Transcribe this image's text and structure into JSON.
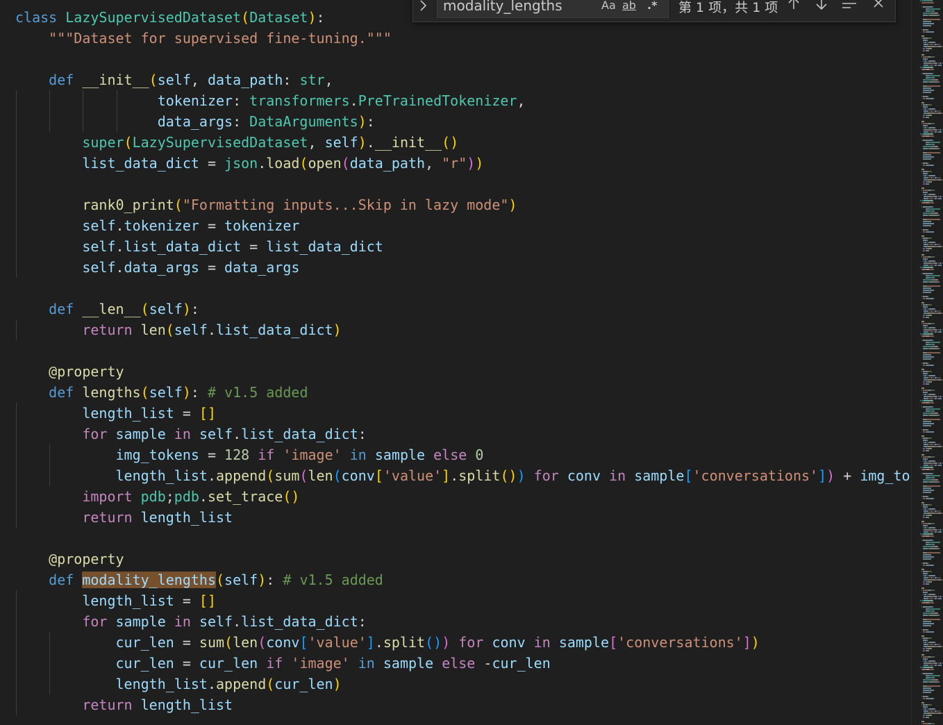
{
  "find_widget": {
    "query": "modality_lengths",
    "match_case_label": "Aa",
    "whole_word_label": "ab",
    "regex_label": ".*",
    "result_count": "第 1 项，共 1 项",
    "toggle_replace_icon": "chevron-right-icon",
    "previous_match_icon": "arrow-up-icon",
    "next_match_icon": "arrow-down-icon",
    "find_in_selection_icon": "lines-icon",
    "close_icon": "close-icon"
  },
  "code": {
    "lines": [
      [
        {
          "t": "class",
          "c": "kw"
        },
        {
          "t": " "
        },
        {
          "t": "LazySupervisedDataset",
          "c": "cls"
        },
        {
          "t": "(",
          "c": "b1"
        },
        {
          "t": "Dataset",
          "c": "cls"
        },
        {
          "t": ")",
          "c": "b1"
        },
        {
          "t": ":"
        }
      ],
      [
        {
          "t": "    "
        },
        {
          "t": "\"\"\"Dataset for supervised fine-tuning.\"\"\"",
          "c": "str"
        }
      ],
      [],
      [
        {
          "t": "    "
        },
        {
          "t": "def",
          "c": "kw"
        },
        {
          "t": " "
        },
        {
          "t": "__init__",
          "c": "fn"
        },
        {
          "t": "(",
          "c": "b1"
        },
        {
          "t": "self",
          "c": "var"
        },
        {
          "t": ", "
        },
        {
          "t": "data_path",
          "c": "var"
        },
        {
          "t": ": "
        },
        {
          "t": "str",
          "c": "cls"
        },
        {
          "t": ","
        }
      ],
      [
        {
          "t": "                 "
        },
        {
          "t": "tokenizer",
          "c": "var"
        },
        {
          "t": ": "
        },
        {
          "t": "transformers",
          "c": "cls"
        },
        {
          "t": "."
        },
        {
          "t": "PreTrainedTokenizer",
          "c": "cls"
        },
        {
          "t": ","
        }
      ],
      [
        {
          "t": "                 "
        },
        {
          "t": "data_args",
          "c": "var"
        },
        {
          "t": ": "
        },
        {
          "t": "DataArguments",
          "c": "cls"
        },
        {
          "t": ")",
          "c": "b1"
        },
        {
          "t": ":"
        }
      ],
      [
        {
          "t": "        "
        },
        {
          "t": "super",
          "c": "cls"
        },
        {
          "t": "(",
          "c": "b1"
        },
        {
          "t": "LazySupervisedDataset",
          "c": "cls"
        },
        {
          "t": ", "
        },
        {
          "t": "self",
          "c": "var"
        },
        {
          "t": ")",
          "c": "b1"
        },
        {
          "t": "."
        },
        {
          "t": "__init__",
          "c": "fn"
        },
        {
          "t": "()",
          "c": "b1"
        }
      ],
      [
        {
          "t": "        "
        },
        {
          "t": "list_data_dict",
          "c": "var"
        },
        {
          "t": " = "
        },
        {
          "t": "json",
          "c": "cls"
        },
        {
          "t": "."
        },
        {
          "t": "load",
          "c": "fn"
        },
        {
          "t": "(",
          "c": "b1"
        },
        {
          "t": "open",
          "c": "fn"
        },
        {
          "t": "(",
          "c": "b2"
        },
        {
          "t": "data_path",
          "c": "var"
        },
        {
          "t": ", "
        },
        {
          "t": "\"r\"",
          "c": "str"
        },
        {
          "t": ")",
          "c": "b2"
        },
        {
          "t": ")",
          "c": "b1"
        }
      ],
      [],
      [
        {
          "t": "        "
        },
        {
          "t": "rank0_print",
          "c": "fn"
        },
        {
          "t": "(",
          "c": "b1"
        },
        {
          "t": "\"Formatting inputs...Skip in lazy mode\"",
          "c": "str"
        },
        {
          "t": ")",
          "c": "b1"
        }
      ],
      [
        {
          "t": "        "
        },
        {
          "t": "self",
          "c": "var"
        },
        {
          "t": "."
        },
        {
          "t": "tokenizer",
          "c": "var"
        },
        {
          "t": " = "
        },
        {
          "t": "tokenizer",
          "c": "var"
        }
      ],
      [
        {
          "t": "        "
        },
        {
          "t": "self",
          "c": "var"
        },
        {
          "t": "."
        },
        {
          "t": "list_data_dict",
          "c": "var"
        },
        {
          "t": " = "
        },
        {
          "t": "list_data_dict",
          "c": "var"
        }
      ],
      [
        {
          "t": "        "
        },
        {
          "t": "self",
          "c": "var"
        },
        {
          "t": "."
        },
        {
          "t": "data_args",
          "c": "var"
        },
        {
          "t": " = "
        },
        {
          "t": "data_args",
          "c": "var"
        }
      ],
      [],
      [
        {
          "t": "    "
        },
        {
          "t": "def",
          "c": "kw"
        },
        {
          "t": " "
        },
        {
          "t": "__len__",
          "c": "fn"
        },
        {
          "t": "(",
          "c": "b1"
        },
        {
          "t": "self",
          "c": "var"
        },
        {
          "t": ")",
          "c": "b1"
        },
        {
          "t": ":"
        }
      ],
      [
        {
          "t": "        "
        },
        {
          "t": "return",
          "c": "ctl"
        },
        {
          "t": " "
        },
        {
          "t": "len",
          "c": "fn"
        },
        {
          "t": "(",
          "c": "b1"
        },
        {
          "t": "self",
          "c": "var"
        },
        {
          "t": "."
        },
        {
          "t": "list_data_dict",
          "c": "var"
        },
        {
          "t": ")",
          "c": "b1"
        }
      ],
      [],
      [
        {
          "t": "    "
        },
        {
          "t": "@property",
          "c": "dec"
        }
      ],
      [
        {
          "t": "    "
        },
        {
          "t": "def",
          "c": "kw"
        },
        {
          "t": " "
        },
        {
          "t": "lengths",
          "c": "fn"
        },
        {
          "t": "(",
          "c": "b1"
        },
        {
          "t": "self",
          "c": "var"
        },
        {
          "t": ")",
          "c": "b1"
        },
        {
          "t": ": "
        },
        {
          "t": "# v1.5 added",
          "c": "com"
        }
      ],
      [
        {
          "t": "        "
        },
        {
          "t": "length_list",
          "c": "var"
        },
        {
          "t": " = "
        },
        {
          "t": "[]",
          "c": "b1"
        }
      ],
      [
        {
          "t": "        "
        },
        {
          "t": "for",
          "c": "ctl"
        },
        {
          "t": " "
        },
        {
          "t": "sample",
          "c": "var"
        },
        {
          "t": " "
        },
        {
          "t": "in",
          "c": "ctl"
        },
        {
          "t": " "
        },
        {
          "t": "self",
          "c": "var"
        },
        {
          "t": "."
        },
        {
          "t": "list_data_dict",
          "c": "var"
        },
        {
          "t": ":"
        }
      ],
      [
        {
          "t": "            "
        },
        {
          "t": "img_tokens",
          "c": "var"
        },
        {
          "t": " = "
        },
        {
          "t": "128",
          "c": "num"
        },
        {
          "t": " "
        },
        {
          "t": "if",
          "c": "ctl"
        },
        {
          "t": " "
        },
        {
          "t": "'image'",
          "c": "str"
        },
        {
          "t": " "
        },
        {
          "t": "in",
          "c": "kw"
        },
        {
          "t": " "
        },
        {
          "t": "sample",
          "c": "var"
        },
        {
          "t": " "
        },
        {
          "t": "else",
          "c": "ctl"
        },
        {
          "t": " "
        },
        {
          "t": "0",
          "c": "num"
        }
      ],
      [
        {
          "t": "            "
        },
        {
          "t": "length_list",
          "c": "var"
        },
        {
          "t": "."
        },
        {
          "t": "append",
          "c": "fn"
        },
        {
          "t": "(",
          "c": "b1"
        },
        {
          "t": "sum",
          "c": "fn"
        },
        {
          "t": "(",
          "c": "b2"
        },
        {
          "t": "len",
          "c": "fn"
        },
        {
          "t": "(",
          "c": "b3"
        },
        {
          "t": "conv",
          "c": "var"
        },
        {
          "t": "[",
          "c": "b1"
        },
        {
          "t": "'value'",
          "c": "str"
        },
        {
          "t": "]",
          "c": "b1"
        },
        {
          "t": "."
        },
        {
          "t": "split",
          "c": "fn"
        },
        {
          "t": "()",
          "c": "b1"
        },
        {
          "t": ")",
          "c": "b3"
        },
        {
          "t": " "
        },
        {
          "t": "for",
          "c": "ctl"
        },
        {
          "t": " "
        },
        {
          "t": "conv",
          "c": "var"
        },
        {
          "t": " "
        },
        {
          "t": "in",
          "c": "ctl"
        },
        {
          "t": " "
        },
        {
          "t": "sample",
          "c": "var"
        },
        {
          "t": "[",
          "c": "b3"
        },
        {
          "t": "'conversations'",
          "c": "str"
        },
        {
          "t": "]",
          "c": "b3"
        },
        {
          "t": ")",
          "c": "b2"
        },
        {
          "t": " + "
        },
        {
          "t": "img_tokens",
          "c": "var"
        },
        {
          "t": ")",
          "c": "b1"
        }
      ],
      [
        {
          "t": "        "
        },
        {
          "t": "import",
          "c": "ctl"
        },
        {
          "t": " "
        },
        {
          "t": "pdb",
          "c": "cls"
        },
        {
          "t": ";"
        },
        {
          "t": "pdb",
          "c": "cls"
        },
        {
          "t": "."
        },
        {
          "t": "set_trace",
          "c": "fn"
        },
        {
          "t": "()",
          "c": "b1"
        }
      ],
      [
        {
          "t": "        "
        },
        {
          "t": "return",
          "c": "ctl"
        },
        {
          "t": " "
        },
        {
          "t": "length_list",
          "c": "var"
        }
      ],
      [],
      [
        {
          "t": "    "
        },
        {
          "t": "@property",
          "c": "dec"
        }
      ],
      [
        {
          "t": "    "
        },
        {
          "t": "def",
          "c": "kw"
        },
        {
          "t": " "
        },
        {
          "t": "modality_lengths",
          "c": "hl"
        },
        {
          "t": "(",
          "c": "b1"
        },
        {
          "t": "self",
          "c": "var"
        },
        {
          "t": ")",
          "c": "b1"
        },
        {
          "t": ": "
        },
        {
          "t": "# v1.5 added",
          "c": "com"
        }
      ],
      [
        {
          "t": "        "
        },
        {
          "t": "length_list",
          "c": "var"
        },
        {
          "t": " = "
        },
        {
          "t": "[]",
          "c": "b1"
        }
      ],
      [
        {
          "t": "        "
        },
        {
          "t": "for",
          "c": "ctl"
        },
        {
          "t": " "
        },
        {
          "t": "sample",
          "c": "var"
        },
        {
          "t": " "
        },
        {
          "t": "in",
          "c": "ctl"
        },
        {
          "t": " "
        },
        {
          "t": "self",
          "c": "var"
        },
        {
          "t": "."
        },
        {
          "t": "list_data_dict",
          "c": "var"
        },
        {
          "t": ":"
        }
      ],
      [
        {
          "t": "            "
        },
        {
          "t": "cur_len",
          "c": "var"
        },
        {
          "t": " = "
        },
        {
          "t": "sum",
          "c": "fn"
        },
        {
          "t": "(",
          "c": "b1"
        },
        {
          "t": "len",
          "c": "fn"
        },
        {
          "t": "(",
          "c": "b2"
        },
        {
          "t": "conv",
          "c": "var"
        },
        {
          "t": "[",
          "c": "b3"
        },
        {
          "t": "'value'",
          "c": "str"
        },
        {
          "t": "]",
          "c": "b3"
        },
        {
          "t": "."
        },
        {
          "t": "split",
          "c": "fn"
        },
        {
          "t": "()",
          "c": "b3"
        },
        {
          "t": ")",
          "c": "b2"
        },
        {
          "t": " "
        },
        {
          "t": "for",
          "c": "ctl"
        },
        {
          "t": " "
        },
        {
          "t": "conv",
          "c": "var"
        },
        {
          "t": " "
        },
        {
          "t": "in",
          "c": "ctl"
        },
        {
          "t": " "
        },
        {
          "t": "sample",
          "c": "var"
        },
        {
          "t": "[",
          "c": "b2"
        },
        {
          "t": "'conversations'",
          "c": "str"
        },
        {
          "t": "]",
          "c": "b2"
        },
        {
          "t": ")",
          "c": "b1"
        }
      ],
      [
        {
          "t": "            "
        },
        {
          "t": "cur_len",
          "c": "var"
        },
        {
          "t": " = "
        },
        {
          "t": "cur_len",
          "c": "var"
        },
        {
          "t": " "
        },
        {
          "t": "if",
          "c": "ctl"
        },
        {
          "t": " "
        },
        {
          "t": "'image'",
          "c": "str"
        },
        {
          "t": " "
        },
        {
          "t": "in",
          "c": "kw"
        },
        {
          "t": " "
        },
        {
          "t": "sample",
          "c": "var"
        },
        {
          "t": " "
        },
        {
          "t": "else",
          "c": "ctl"
        },
        {
          "t": " -"
        },
        {
          "t": "cur_len",
          "c": "var"
        }
      ],
      [
        {
          "t": "            "
        },
        {
          "t": "length_list",
          "c": "var"
        },
        {
          "t": "."
        },
        {
          "t": "append",
          "c": "fn"
        },
        {
          "t": "(",
          "c": "b1"
        },
        {
          "t": "cur_len",
          "c": "var"
        },
        {
          "t": ")",
          "c": "b1"
        }
      ],
      [
        {
          "t": "        "
        },
        {
          "t": "return",
          "c": "ctl"
        },
        {
          "t": " "
        },
        {
          "t": "length_list",
          "c": "var"
        }
      ]
    ]
  }
}
